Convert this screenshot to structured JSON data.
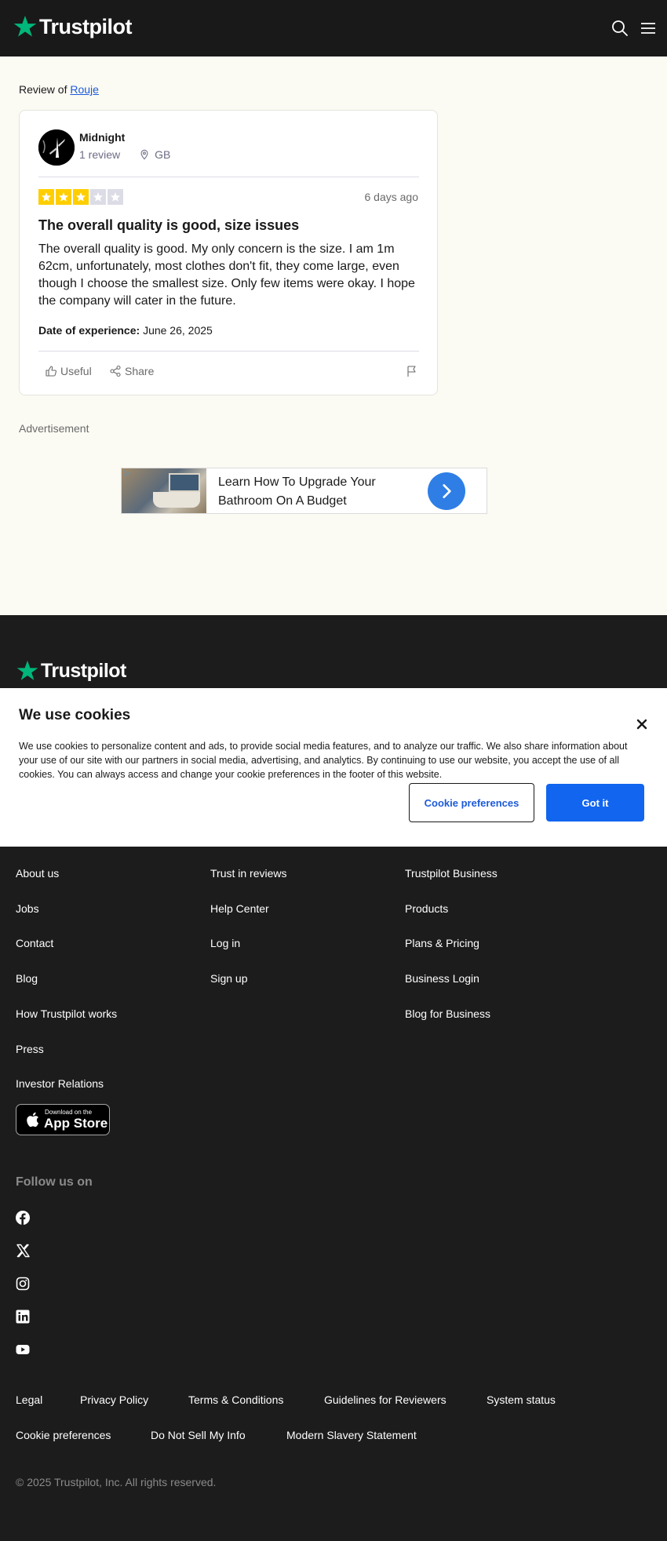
{
  "header": {
    "brand": "Trustpilot",
    "brand_color": "#00b67a",
    "icons": [
      "search-icon",
      "menu-icon"
    ]
  },
  "review_of": {
    "prefix": "Review of",
    "company": "Rouje"
  },
  "review": {
    "user_name": "Midnight",
    "review_count": "1 review",
    "country": "GB",
    "rating": 3,
    "max_rating": 5,
    "star_color": "#ffce00",
    "date": "6 days ago",
    "title": "The overall quality is good, size issues",
    "body": "The overall quality is good. My only concern is the size. I am 1m 62cm, unfortunately, most clothes don't fit, they come large, even though I choose the smallest size. Only few items were okay. I hope the company will cater in the future.",
    "experience_label": "Date of experience:",
    "experience_date": "June 26, 2025",
    "useful_label": "Useful",
    "share_label": "Share"
  },
  "ad": {
    "label": "Advertisement",
    "text": "Learn How To Upgrade Your Bathroom On A Budget"
  },
  "footer": {
    "brand": "Trustpilot",
    "col1": [
      "About us",
      "Jobs",
      "Contact",
      "Blog",
      "How Trustpilot works",
      "Press",
      "Investor Relations"
    ],
    "col2": [
      "Trust in reviews",
      "Help Center",
      "Log in",
      "Sign up"
    ],
    "col3": [
      "Trustpilot Business",
      "Products",
      "Plans & Pricing",
      "Business Login",
      "Blog for Business"
    ],
    "app_store_small": "Download on the",
    "app_store_big": "App Store",
    "follow_label": "Follow us on",
    "social": [
      "facebook-icon",
      "x-icon",
      "instagram-icon",
      "linkedin-icon",
      "youtube-icon"
    ],
    "bottom_row1": [
      "Legal",
      "Privacy Policy",
      "Terms & Conditions",
      "Guidelines for Reviewers",
      "System status"
    ],
    "bottom_row2": [
      "Cookie preferences",
      "Do Not Sell My Info",
      "Modern Slavery Statement"
    ],
    "copyright": "© 2025 Trustpilot, Inc. All rights reserved."
  },
  "cookie": {
    "title": "We use cookies",
    "text": "We use cookies to personalize content and ads, to provide social media features, and to analyze our traffic. We also share information about your use of our site with our partners in social media, advertising, and analytics. By continuing to use our website, you accept the use of all cookies. You can always access and change your cookie preferences in the footer of this website.",
    "preferences_label": "Cookie preferences",
    "accept_label": "Got it"
  }
}
